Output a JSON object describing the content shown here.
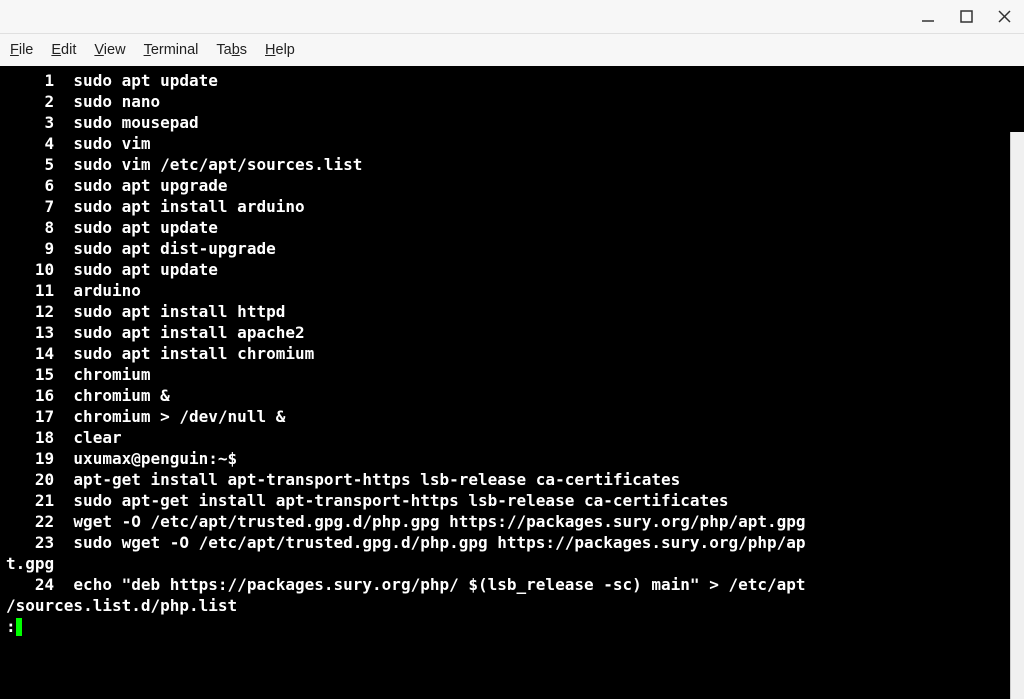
{
  "window": {
    "minimize": "—",
    "maximize": "□",
    "close": "✕"
  },
  "menu": {
    "file": "File",
    "edit": "Edit",
    "view": "View",
    "terminal": "Terminal",
    "tabs": "Tabs",
    "help": "Help"
  },
  "history": [
    {
      "n": 1,
      "cmd": "sudo apt update"
    },
    {
      "n": 2,
      "cmd": "sudo nano"
    },
    {
      "n": 3,
      "cmd": "sudo mousepad"
    },
    {
      "n": 4,
      "cmd": "sudo vim"
    },
    {
      "n": 5,
      "cmd": "sudo vim /etc/apt/sources.list"
    },
    {
      "n": 6,
      "cmd": "sudo apt upgrade"
    },
    {
      "n": 7,
      "cmd": "sudo apt install arduino"
    },
    {
      "n": 8,
      "cmd": "sudo apt update"
    },
    {
      "n": 9,
      "cmd": "sudo apt dist-upgrade"
    },
    {
      "n": 10,
      "cmd": "sudo apt update"
    },
    {
      "n": 11,
      "cmd": "arduino"
    },
    {
      "n": 12,
      "cmd": "sudo apt install httpd"
    },
    {
      "n": 13,
      "cmd": "sudo apt install apache2"
    },
    {
      "n": 14,
      "cmd": "sudo apt install chromium"
    },
    {
      "n": 15,
      "cmd": "chromium"
    },
    {
      "n": 16,
      "cmd": "chromium &"
    },
    {
      "n": 17,
      "cmd": "chromium > /dev/null &"
    },
    {
      "n": 18,
      "cmd": "clear"
    },
    {
      "n": 19,
      "cmd": "uxumax@penguin:~$"
    },
    {
      "n": 20,
      "cmd": "apt-get install apt-transport-https lsb-release ca-certificates"
    },
    {
      "n": 21,
      "cmd": "sudo apt-get install apt-transport-https lsb-release ca-certificates"
    },
    {
      "n": 22,
      "cmd": "wget -O /etc/apt/trusted.gpg.d/php.gpg https://packages.sury.org/php/apt.gpg"
    },
    {
      "n": 23,
      "cmd": "sudo wget -O /etc/apt/trusted.gpg.d/php.gpg https://packages.sury.org/php/apt.gpg"
    },
    {
      "n": 24,
      "cmd": "echo \"deb https://packages.sury.org/php/ $(lsb_release -sc) main\" > /etc/apt/sources.list.d/php.list"
    }
  ],
  "prompt": ":",
  "wrapped": {
    "23_tail": "t.gpg",
    "24_tail": "/sources.list.d/php.list"
  }
}
